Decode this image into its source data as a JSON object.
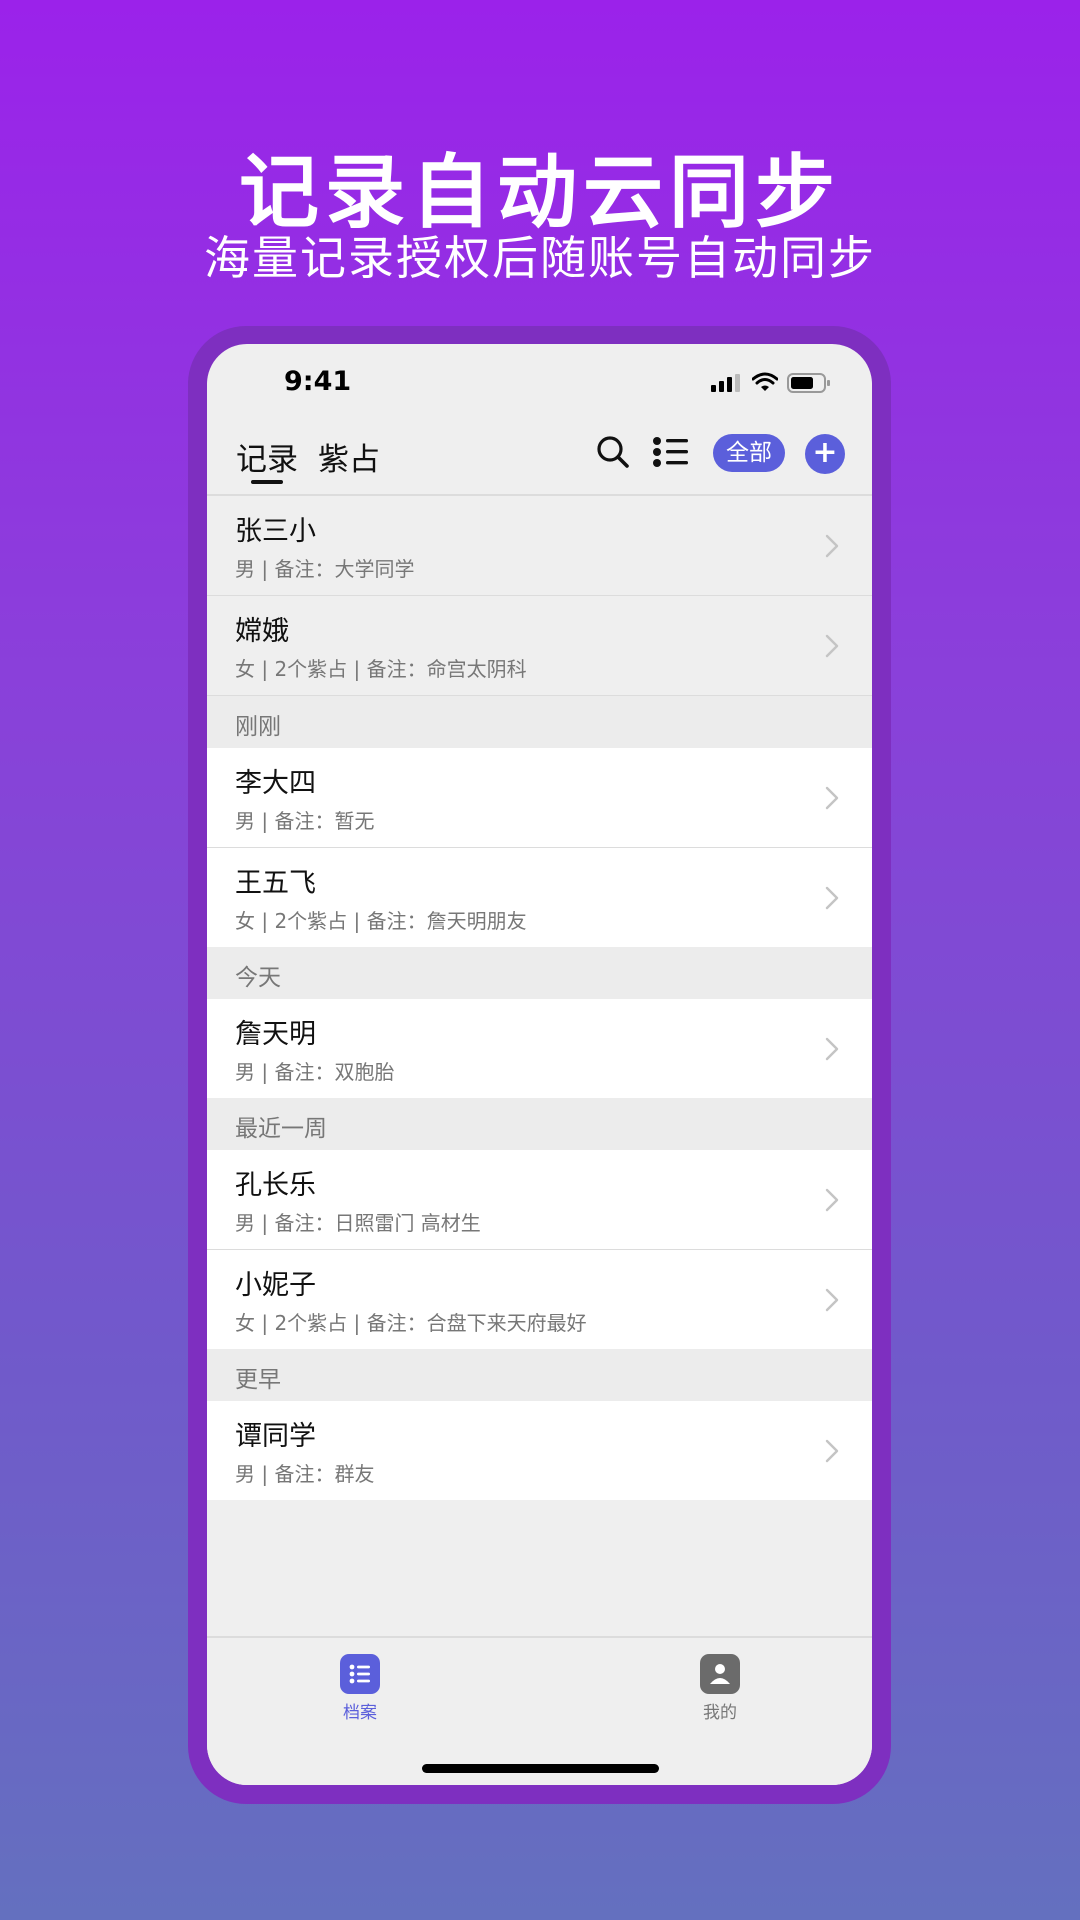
{
  "banner": {
    "headline": "记录自动云同步",
    "subline": "海量记录授权后随账号自动同步"
  },
  "status_bar": {
    "time": "9:41"
  },
  "nav": {
    "tabs": [
      {
        "label": "记录",
        "active": true
      },
      {
        "label": "紫占",
        "active": false
      }
    ],
    "icons": [
      "search-icon",
      "list-icon"
    ],
    "filter_label": "全部",
    "add_symbol": "+",
    "accent_color": "#5b5fdb"
  },
  "pinned": [
    {
      "name": "张三小",
      "meta": "男 | 备注：大学同学"
    },
    {
      "name": "嫦娥",
      "meta": "女 | 2个紫占 | 备注：命宫太阴科"
    }
  ],
  "sections": [
    {
      "title": "刚刚",
      "items": [
        {
          "name": "李大四",
          "meta": "男 | 备注：暂无"
        },
        {
          "name": "王五飞",
          "meta": "女 | 2个紫占 | 备注：詹天明朋友"
        }
      ]
    },
    {
      "title": "今天",
      "items": [
        {
          "name": "詹天明",
          "meta": "男 | 备注：双胞胎"
        }
      ]
    },
    {
      "title": "最近一周",
      "items": [
        {
          "name": "孔长乐",
          "meta": "男 | 备注：日照雷门 高材生"
        },
        {
          "name": "小妮子",
          "meta": "女 | 2个紫占 | 备注：合盘下来天府最好"
        }
      ]
    },
    {
      "title": "更早",
      "items": [
        {
          "name": "谭同学",
          "meta": "男 | 备注：群友"
        }
      ]
    }
  ],
  "tab_bar": {
    "items": [
      {
        "label": "档案",
        "icon": "list-icon",
        "active": true
      },
      {
        "label": "我的",
        "icon": "person-icon",
        "active": false
      }
    ]
  }
}
